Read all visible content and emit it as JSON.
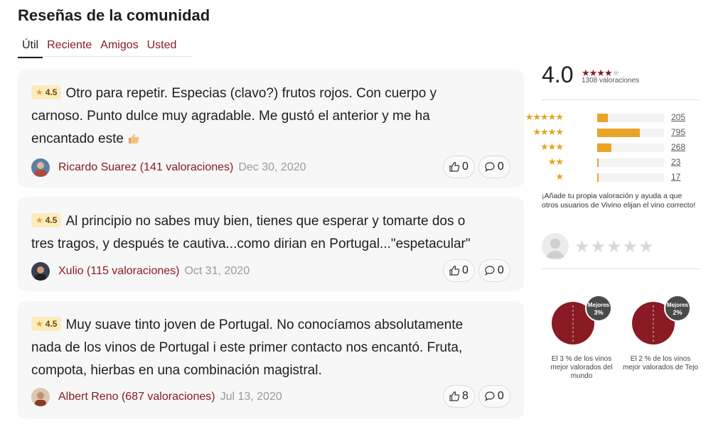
{
  "header": {
    "title": "Reseñas de la comunidad"
  },
  "tabs": [
    {
      "label": "Útil",
      "active": true
    },
    {
      "label": "Reciente",
      "active": false
    },
    {
      "label": "Amigos",
      "active": false
    },
    {
      "label": "Usted",
      "active": false
    }
  ],
  "reviews": [
    {
      "rating": "4.5",
      "lines": [
        "Otro para repetir. Especias (clavo?) frutos rojos. Con cuerpo y",
        "carnoso. Punto dulce muy agradable. Me gustó el anterior y me ha",
        "encantado este"
      ],
      "author": "Ricardo Suarez (141 valoraciones)",
      "date": "Dec 30, 2020",
      "likes": "0",
      "comments": "0"
    },
    {
      "rating": "4.5",
      "lines": [
        "Al principio no sabes muy bien, tienes que esperar y tomarte dos o",
        "tres tragos, y después te cautiva...como dirian en Portugal...\"espetacular\""
      ],
      "author": "Xulio (115 valoraciones)",
      "date": "Oct 31, 2020",
      "likes": "0",
      "comments": "0"
    },
    {
      "rating": "4.5",
      "lines": [
        "Muy suave tinto joven de Portugal. No conocíamos absolutamente",
        "nada de los vinos de Portugal i este primer contacto nos encantó. Fruta,",
        "compota, hierbas en una combinación magistral."
      ],
      "author": "Albert Reno (687 valoraciones)",
      "date": "Jul 13, 2020",
      "likes": "8",
      "comments": "0"
    }
  ],
  "summary": {
    "average": "4.0",
    "count_label": "1308 valoraciones",
    "distribution": [
      {
        "stars": "★★★★★",
        "count": "205",
        "value": 205
      },
      {
        "stars": "★★★★",
        "count": "795",
        "value": 795
      },
      {
        "stars": "★★★",
        "count": "268",
        "value": 268
      },
      {
        "stars": "★★",
        "count": "23",
        "value": 23
      },
      {
        "stars": "★",
        "count": "17",
        "value": 17
      }
    ],
    "cta": "¡Añade tu propia valoración y ayuda a que otros usuarios de Vivino elijan el vino correcto!"
  },
  "rankings": [
    {
      "badge_top": "Mejores",
      "badge_pct": "3%",
      "caption": "El 3 % de los vinos mejor valorados del mundo"
    },
    {
      "badge_top": "Mejores",
      "badge_pct": "2%",
      "caption": "El 2 % de los vinos mejor valorados de Tejo"
    }
  ],
  "colors": {
    "brand": "#8a1a23",
    "star": "#e6a21b",
    "bar": "#e9a428"
  }
}
